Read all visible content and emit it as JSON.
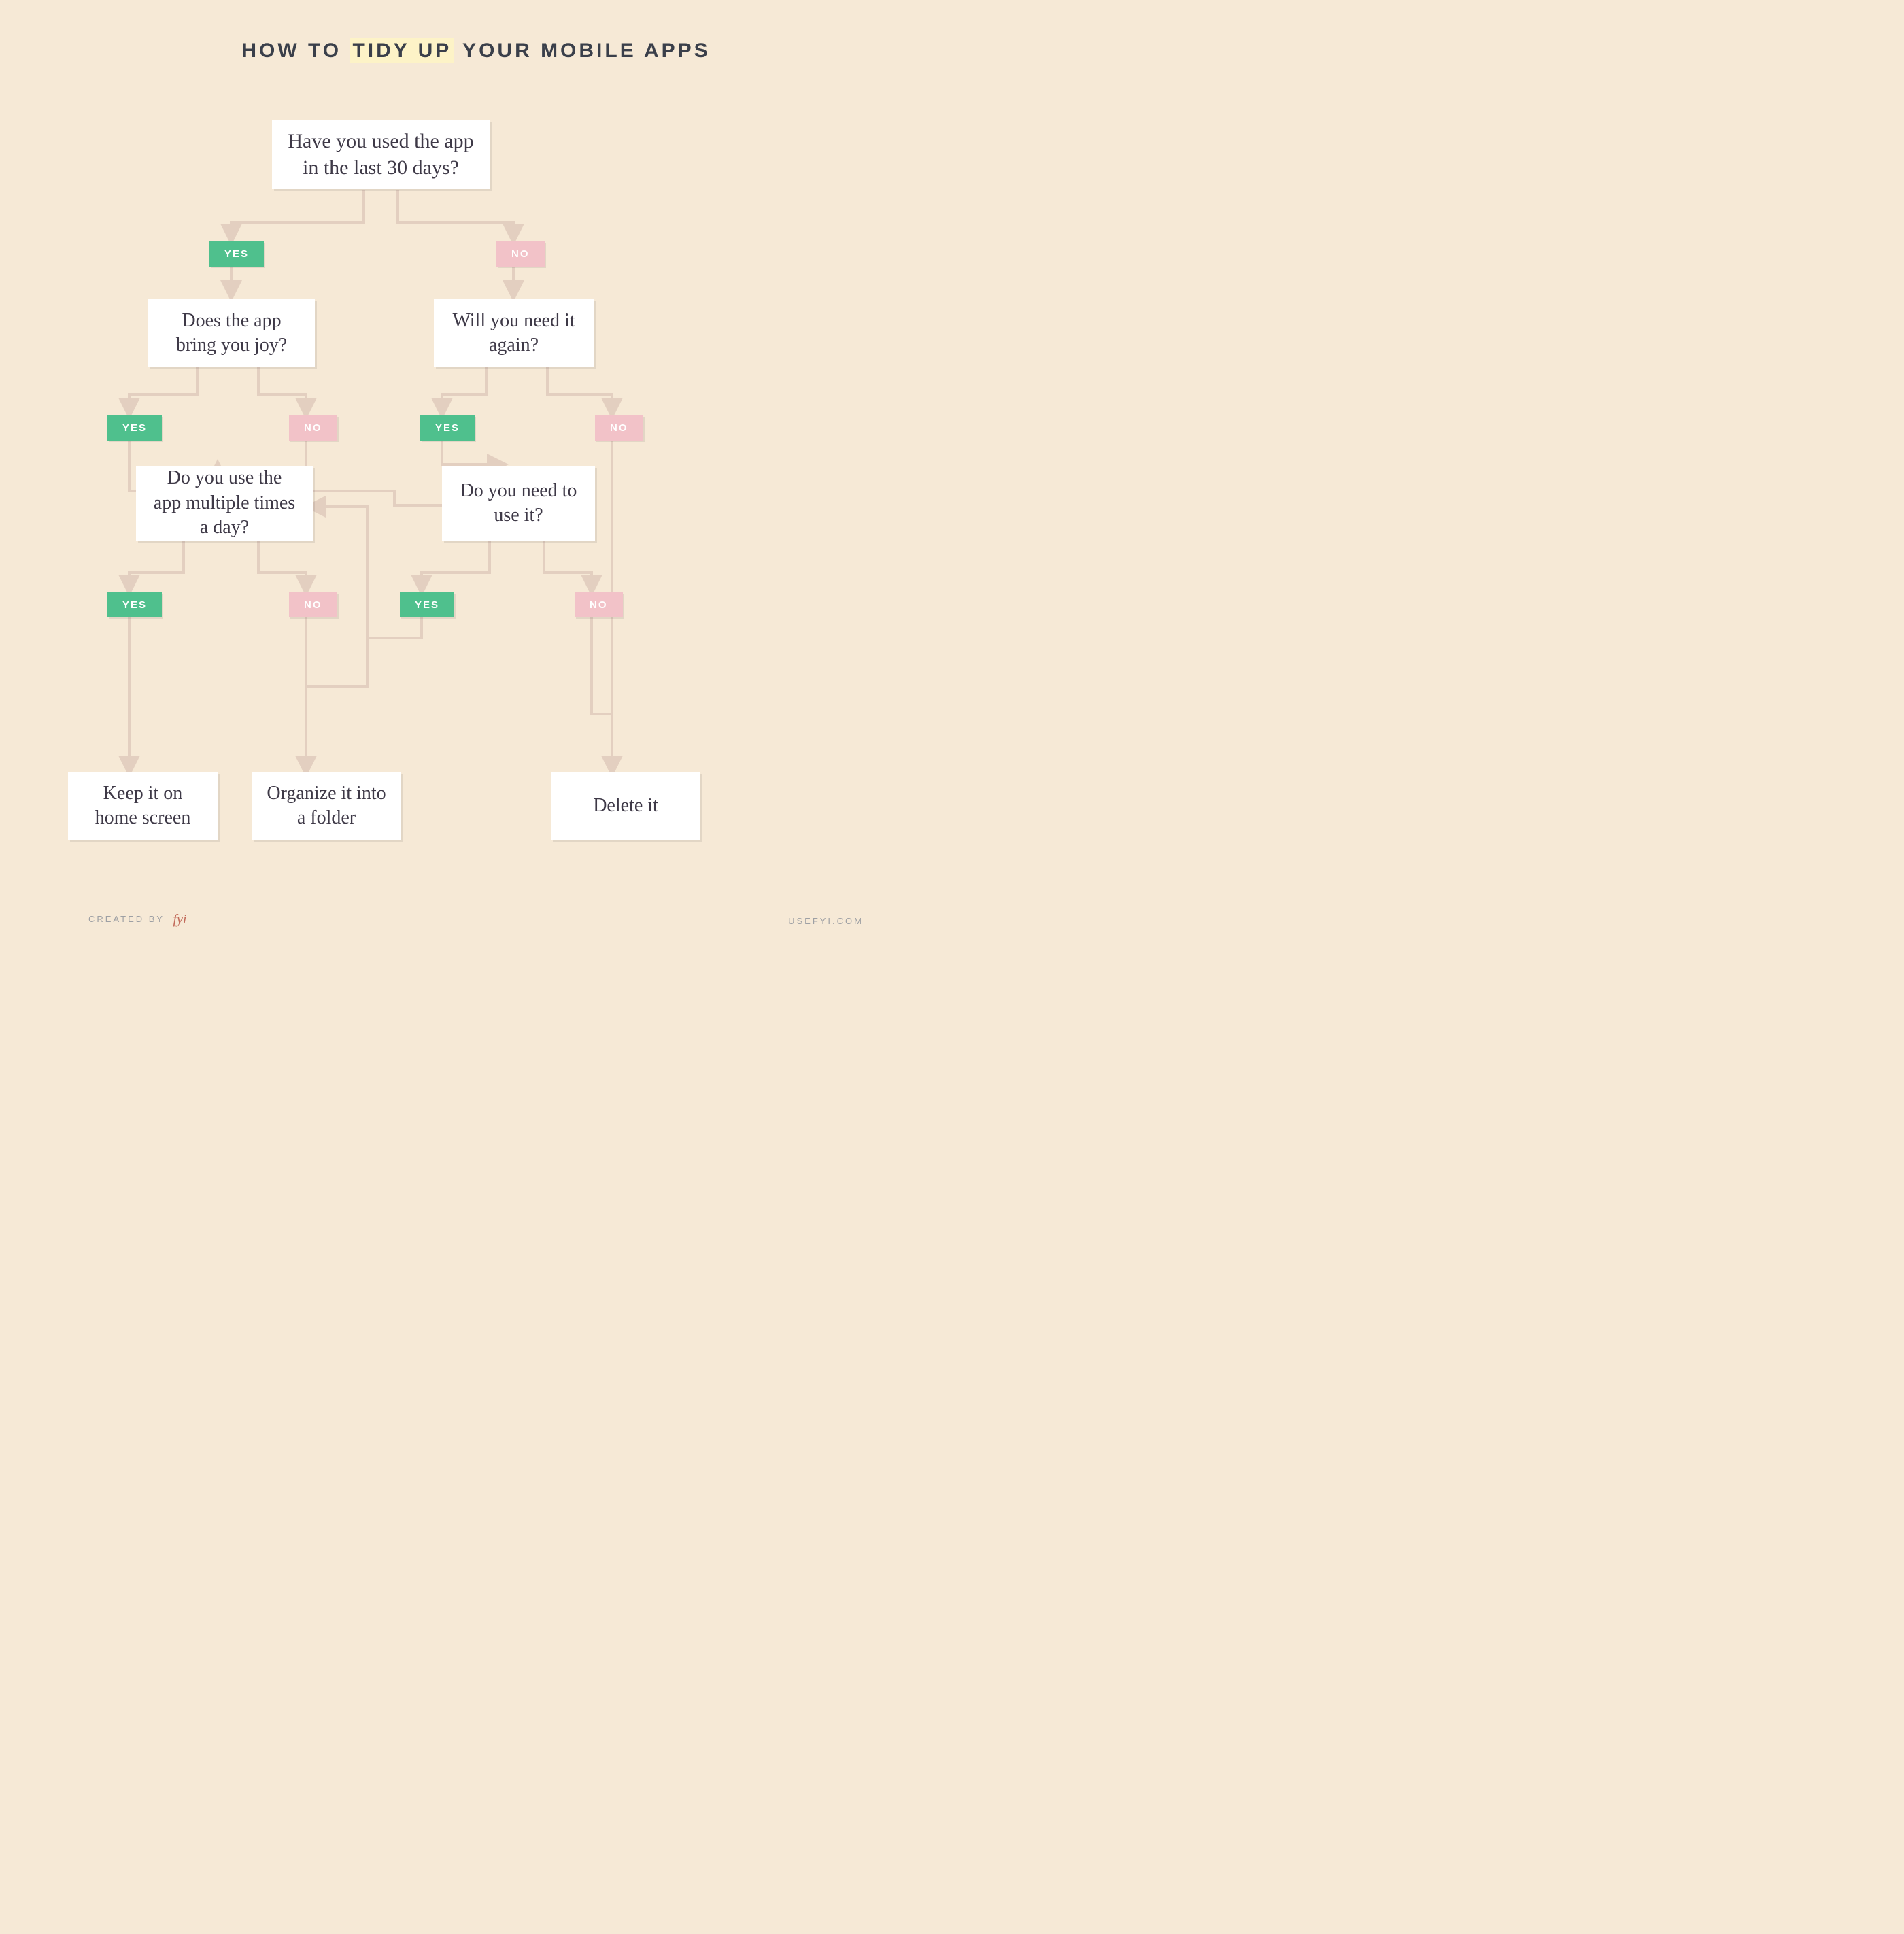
{
  "title": {
    "pre": "HOW TO ",
    "hl": "TIDY UP",
    "post": " YOUR MOBILE APPS"
  },
  "labels": {
    "yes": "YES",
    "no": "NO"
  },
  "nodes": {
    "q1": "Have you used the app in the last 30 days?",
    "q2": "Does the app bring you joy?",
    "q3": "Will you need it again?",
    "q4": "Do you use the app multiple times a day?",
    "q5": "Do you need to use it?",
    "a1": "Keep it on home screen",
    "a2": "Organize it into a folder",
    "a3": "Delete it"
  },
  "footer": {
    "created_by": "CREATED BY",
    "brand": "fyi",
    "url": "USEFYI.COM"
  },
  "flow": {
    "description": "Decision flowchart. q1 YES→q2, q1 NO→q3. q2 YES→q4, q2 NO→q5. q3 YES→q5, q3 NO→a3. q4 YES→a1, q4 NO→a2. q5 YES→q4, q5 NO→a3.",
    "edges": [
      {
        "from": "q1",
        "answer": "yes",
        "to": "q2"
      },
      {
        "from": "q1",
        "answer": "no",
        "to": "q3"
      },
      {
        "from": "q2",
        "answer": "yes",
        "to": "q4"
      },
      {
        "from": "q2",
        "answer": "no",
        "to": "q5"
      },
      {
        "from": "q3",
        "answer": "yes",
        "to": "q5"
      },
      {
        "from": "q3",
        "answer": "no",
        "to": "a3"
      },
      {
        "from": "q4",
        "answer": "yes",
        "to": "a1"
      },
      {
        "from": "q4",
        "answer": "no",
        "to": "a2"
      },
      {
        "from": "q5",
        "answer": "yes",
        "to": "q4"
      },
      {
        "from": "q5",
        "answer": "no",
        "to": "a3"
      }
    ]
  }
}
